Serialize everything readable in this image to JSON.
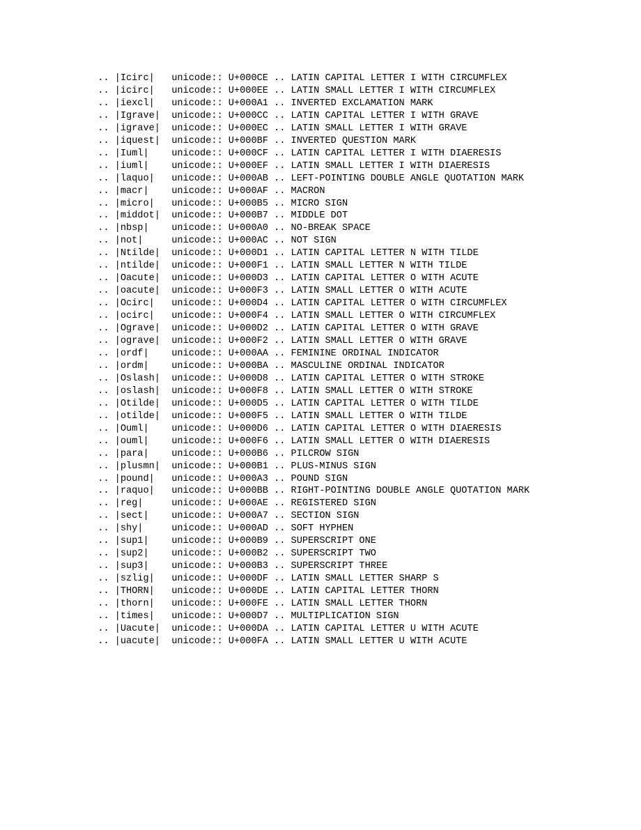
{
  "document": {
    "kind": "plain-text-substitution-list",
    "directive_marker": "..",
    "role": "unicode::",
    "separator": "..",
    "name_field_width": 8,
    "entries": [
      {
        "name": "Icirc",
        "codepoint": "U+000CE",
        "description": "LATIN CAPITAL LETTER I WITH CIRCUMFLEX"
      },
      {
        "name": "icirc",
        "codepoint": "U+000EE",
        "description": "LATIN SMALL LETTER I WITH CIRCUMFLEX"
      },
      {
        "name": "iexcl",
        "codepoint": "U+000A1",
        "description": "INVERTED EXCLAMATION MARK"
      },
      {
        "name": "Igrave",
        "codepoint": "U+000CC",
        "description": "LATIN CAPITAL LETTER I WITH GRAVE"
      },
      {
        "name": "igrave",
        "codepoint": "U+000EC",
        "description": "LATIN SMALL LETTER I WITH GRAVE"
      },
      {
        "name": "iquest",
        "codepoint": "U+000BF",
        "description": "INVERTED QUESTION MARK"
      },
      {
        "name": "Iuml",
        "codepoint": "U+000CF",
        "description": "LATIN CAPITAL LETTER I WITH DIAERESIS"
      },
      {
        "name": "iuml",
        "codepoint": "U+000EF",
        "description": "LATIN SMALL LETTER I WITH DIAERESIS"
      },
      {
        "name": "laquo",
        "codepoint": "U+000AB",
        "description": "LEFT-POINTING DOUBLE ANGLE QUOTATION MARK"
      },
      {
        "name": "macr",
        "codepoint": "U+000AF",
        "description": "MACRON"
      },
      {
        "name": "micro",
        "codepoint": "U+000B5",
        "description": "MICRO SIGN"
      },
      {
        "name": "middot",
        "codepoint": "U+000B7",
        "description": "MIDDLE DOT"
      },
      {
        "name": "nbsp",
        "codepoint": "U+000A0",
        "description": "NO-BREAK SPACE"
      },
      {
        "name": "not",
        "codepoint": "U+000AC",
        "description": "NOT SIGN"
      },
      {
        "name": "Ntilde",
        "codepoint": "U+000D1",
        "description": "LATIN CAPITAL LETTER N WITH TILDE"
      },
      {
        "name": "ntilde",
        "codepoint": "U+000F1",
        "description": "LATIN SMALL LETTER N WITH TILDE"
      },
      {
        "name": "Oacute",
        "codepoint": "U+000D3",
        "description": "LATIN CAPITAL LETTER O WITH ACUTE"
      },
      {
        "name": "oacute",
        "codepoint": "U+000F3",
        "description": "LATIN SMALL LETTER O WITH ACUTE"
      },
      {
        "name": "Ocirc",
        "codepoint": "U+000D4",
        "description": "LATIN CAPITAL LETTER O WITH CIRCUMFLEX"
      },
      {
        "name": "ocirc",
        "codepoint": "U+000F4",
        "description": "LATIN SMALL LETTER O WITH CIRCUMFLEX"
      },
      {
        "name": "Ograve",
        "codepoint": "U+000D2",
        "description": "LATIN CAPITAL LETTER O WITH GRAVE"
      },
      {
        "name": "ograve",
        "codepoint": "U+000F2",
        "description": "LATIN SMALL LETTER O WITH GRAVE"
      },
      {
        "name": "ordf",
        "codepoint": "U+000AA",
        "description": "FEMININE ORDINAL INDICATOR"
      },
      {
        "name": "ordm",
        "codepoint": "U+000BA",
        "description": "MASCULINE ORDINAL INDICATOR"
      },
      {
        "name": "Oslash",
        "codepoint": "U+000D8",
        "description": "LATIN CAPITAL LETTER O WITH STROKE"
      },
      {
        "name": "oslash",
        "codepoint": "U+000F8",
        "description": "LATIN SMALL LETTER O WITH STROKE"
      },
      {
        "name": "Otilde",
        "codepoint": "U+000D5",
        "description": "LATIN CAPITAL LETTER O WITH TILDE"
      },
      {
        "name": "otilde",
        "codepoint": "U+000F5",
        "description": "LATIN SMALL LETTER O WITH TILDE"
      },
      {
        "name": "Ouml",
        "codepoint": "U+000D6",
        "description": "LATIN CAPITAL LETTER O WITH DIAERESIS"
      },
      {
        "name": "ouml",
        "codepoint": "U+000F6",
        "description": "LATIN SMALL LETTER O WITH DIAERESIS"
      },
      {
        "name": "para",
        "codepoint": "U+000B6",
        "description": "PILCROW SIGN"
      },
      {
        "name": "plusmn",
        "codepoint": "U+000B1",
        "description": "PLUS-MINUS SIGN"
      },
      {
        "name": "pound",
        "codepoint": "U+000A3",
        "description": "POUND SIGN"
      },
      {
        "name": "raquo",
        "codepoint": "U+000BB",
        "description": "RIGHT-POINTING DOUBLE ANGLE QUOTATION MARK"
      },
      {
        "name": "reg",
        "codepoint": "U+000AE",
        "description": "REGISTERED SIGN"
      },
      {
        "name": "sect",
        "codepoint": "U+000A7",
        "description": "SECTION SIGN"
      },
      {
        "name": "shy",
        "codepoint": "U+000AD",
        "description": "SOFT HYPHEN"
      },
      {
        "name": "sup1",
        "codepoint": "U+000B9",
        "description": "SUPERSCRIPT ONE"
      },
      {
        "name": "sup2",
        "codepoint": "U+000B2",
        "description": "SUPERSCRIPT TWO"
      },
      {
        "name": "sup3",
        "codepoint": "U+000B3",
        "description": "SUPERSCRIPT THREE"
      },
      {
        "name": "szlig",
        "codepoint": "U+000DF",
        "description": "LATIN SMALL LETTER SHARP S"
      },
      {
        "name": "THORN",
        "codepoint": "U+000DE",
        "description": "LATIN CAPITAL LETTER THORN"
      },
      {
        "name": "thorn",
        "codepoint": "U+000FE",
        "description": "LATIN SMALL LETTER THORN"
      },
      {
        "name": "times",
        "codepoint": "U+000D7",
        "description": "MULTIPLICATION SIGN"
      },
      {
        "name": "Uacute",
        "codepoint": "U+000DA",
        "description": "LATIN CAPITAL LETTER U WITH ACUTE"
      },
      {
        "name": "uacute",
        "codepoint": "U+000FA",
        "description": "LATIN SMALL LETTER U WITH ACUTE"
      }
    ]
  },
  "colors": {
    "background": "#ffffff",
    "text": "#000000"
  }
}
